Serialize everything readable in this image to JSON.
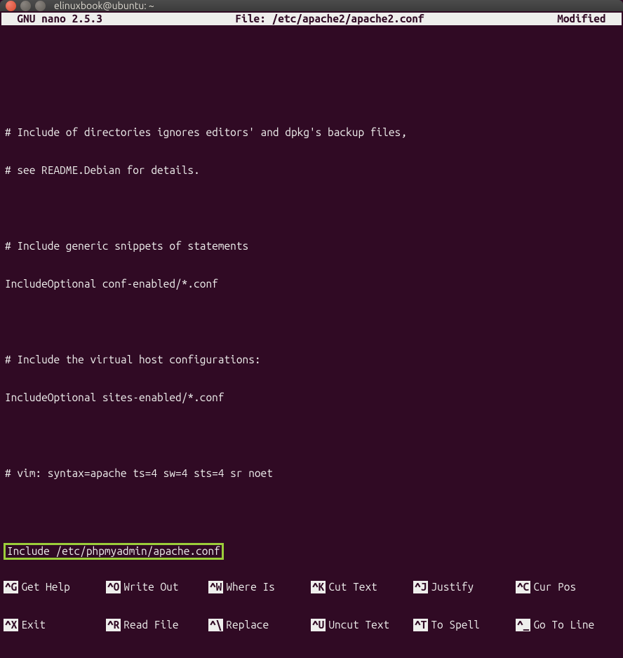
{
  "window": {
    "title": "elinuxbook@ubuntu: ~"
  },
  "nano": {
    "version_label": "  GNU nano 2.5.3",
    "file_label": "File: /etc/apache2/apache2.conf",
    "status": "Modified  "
  },
  "editor": {
    "lines": [
      "",
      "",
      "# Include of directories ignores editors' and dpkg's backup files,",
      "# see README.Debian for details.",
      "",
      "# Include generic snippets of statements",
      "IncludeOptional conf-enabled/*.conf",
      "",
      "# Include the virtual host configurations:",
      "IncludeOptional sites-enabled/*.conf",
      "",
      "# vim: syntax=apache ts=4 sw=4 sts=4 sr noet",
      ""
    ],
    "highlighted_line": "Include /etc/phpmyadmin/apache.conf"
  },
  "shortcuts": {
    "row1": [
      {
        "key": "^G",
        "label": "Get Help"
      },
      {
        "key": "^O",
        "label": "Write Out"
      },
      {
        "key": "^W",
        "label": "Where Is"
      },
      {
        "key": "^K",
        "label": "Cut Text"
      },
      {
        "key": "^J",
        "label": "Justify"
      },
      {
        "key": "^C",
        "label": "Cur Pos"
      }
    ],
    "row2": [
      {
        "key": "^X",
        "label": "Exit"
      },
      {
        "key": "^R",
        "label": "Read File"
      },
      {
        "key": "^\\",
        "label": "Replace"
      },
      {
        "key": "^U",
        "label": "Uncut Text"
      },
      {
        "key": "^T",
        "label": "To Spell"
      },
      {
        "key": "^_",
        "label": "Go To Line"
      }
    ]
  }
}
